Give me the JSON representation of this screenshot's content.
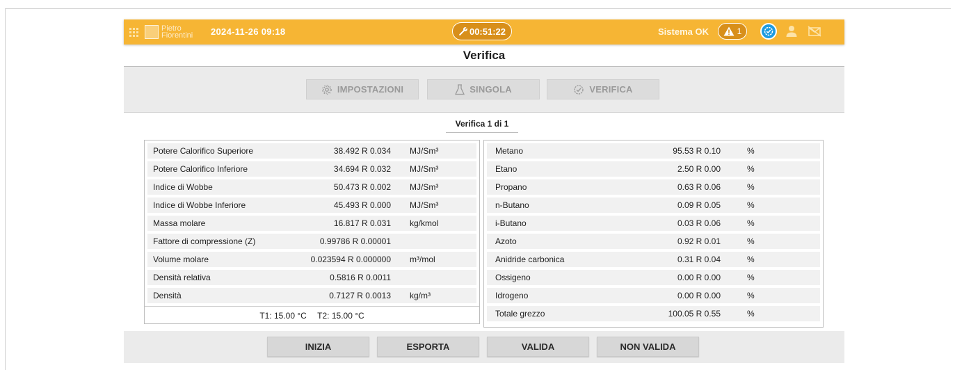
{
  "header": {
    "brand_line1": "Pietro",
    "brand_line2": "Fiorentini",
    "datetime": "2024-11-26 09:18",
    "timer": "00:51:22",
    "system_status": "Sistema OK",
    "alarm_count": "1",
    "accent_color": "#f6b534",
    "icons": [
      "apps-grid-icon",
      "logo-mark",
      "wrench-icon",
      "warning-icon",
      "check-badge-icon",
      "user-icon",
      "mail-off-icon"
    ]
  },
  "page": {
    "title": "Verifica",
    "subtitle": "Verifica 1 di 1"
  },
  "tabs": [
    {
      "label": "IMPOSTAZIONI",
      "icon": "gear-icon"
    },
    {
      "label": "SINGOLA",
      "icon": "flask-icon"
    },
    {
      "label": "VERIFICA",
      "icon": "check-badge-icon"
    }
  ],
  "properties": [
    {
      "label": "Potere Calorifico Superiore",
      "value": "38.492 R 0.034",
      "unit": "MJ/Sm³"
    },
    {
      "label": "Potere Calorifico Inferiore",
      "value": "34.694 R 0.032",
      "unit": "MJ/Sm³"
    },
    {
      "label": "Indice di Wobbe",
      "value": "50.473 R 0.002",
      "unit": "MJ/Sm³"
    },
    {
      "label": "Indice di Wobbe Inferiore",
      "value": "45.493 R 0.000",
      "unit": "MJ/Sm³"
    },
    {
      "label": "Massa molare",
      "value": "16.817 R 0.031",
      "unit": "kg/kmol"
    },
    {
      "label": "Fattore di compressione (Z)",
      "value": "0.99786 R 0.00001",
      "unit": ""
    },
    {
      "label": "Volume molare",
      "value": "0.023594 R 0.000000",
      "unit": "m³/mol"
    },
    {
      "label": "Densità relativa",
      "value": "0.5816 R 0.0011",
      "unit": ""
    },
    {
      "label": "Densità",
      "value": "0.7127 R 0.0013",
      "unit": "kg/m³"
    }
  ],
  "temperatures": {
    "t1": "T1: 15.00 °C",
    "t2": "T2: 15.00 °C"
  },
  "components": [
    {
      "label": "Metano",
      "value": "95.53 R 0.10",
      "unit": "%"
    },
    {
      "label": "Etano",
      "value": "2.50 R 0.00",
      "unit": "%"
    },
    {
      "label": "Propano",
      "value": "0.63 R 0.06",
      "unit": "%"
    },
    {
      "label": "n-Butano",
      "value": "0.09 R 0.05",
      "unit": "%"
    },
    {
      "label": "i-Butano",
      "value": "0.03 R 0.06",
      "unit": "%"
    },
    {
      "label": "Azoto",
      "value": "0.92 R 0.01",
      "unit": "%"
    },
    {
      "label": "Anidride carbonica",
      "value": "0.31 R 0.04",
      "unit": "%"
    },
    {
      "label": "Ossigeno",
      "value": "0.00 R 0.00",
      "unit": "%"
    },
    {
      "label": "Idrogeno",
      "value": "0.00 R 0.00",
      "unit": "%"
    },
    {
      "label": "Totale grezzo",
      "value": "100.05 R 0.55",
      "unit": "%"
    }
  ],
  "actions": {
    "start": "INIZIA",
    "export": "ESPORTA",
    "validate": "VALIDA",
    "invalidate": "NON VALIDA"
  }
}
